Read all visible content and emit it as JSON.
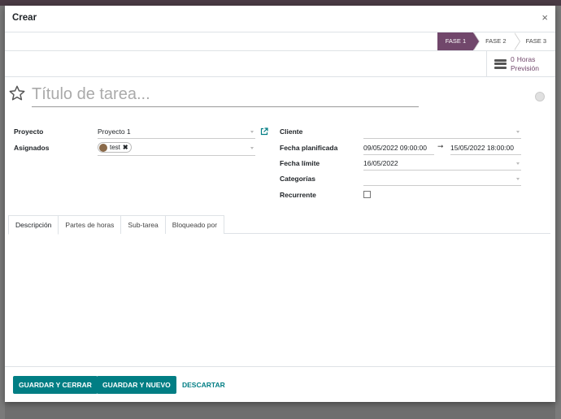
{
  "dialog": {
    "title": "Crear",
    "close_glyph": "×"
  },
  "stages": [
    {
      "label": "FASE 1",
      "active": true
    },
    {
      "label": "FASE 2",
      "active": false
    },
    {
      "label": "FASE 3",
      "active": false
    }
  ],
  "stat_button": {
    "count": "0",
    "label": "Horas",
    "sublabel": "Previsión",
    "icon": "server-icon"
  },
  "task": {
    "title_placeholder": "Título de tarea...",
    "star_icon": "star-icon"
  },
  "left_fields": {
    "project_label": "Proyecto",
    "project_value": "Proyecto 1",
    "assignees_label": "Asignados",
    "assignee_tag": "test",
    "remove_glyph": "✖"
  },
  "right_fields": {
    "customer_label": "Cliente",
    "customer_value": "",
    "planned_label": "Fecha planificada",
    "planned_start": "09/05/2022 09:00:00",
    "planned_arrow": "➞",
    "planned_end": "15/05/2022 18:00:00",
    "deadline_label": "Fecha límite",
    "deadline_value": "16/05/2022",
    "tags_label": "Categorías",
    "tags_value": "",
    "recurring_label": "Recurrente",
    "recurring_checked": false
  },
  "tabs": [
    {
      "label": "Descripción",
      "active": true
    },
    {
      "label": "Partes de horas",
      "active": false
    },
    {
      "label": "Sub-tarea",
      "active": false
    },
    {
      "label": "Bloqueado por",
      "active": false
    }
  ],
  "footer": {
    "save_close": "GUARDAR Y CERRAR",
    "save_new": "GUARDAR Y NUEVO",
    "discard": "DESCARTAR"
  },
  "colors": {
    "brand": "#71476b",
    "primary_button": "#017e84"
  }
}
